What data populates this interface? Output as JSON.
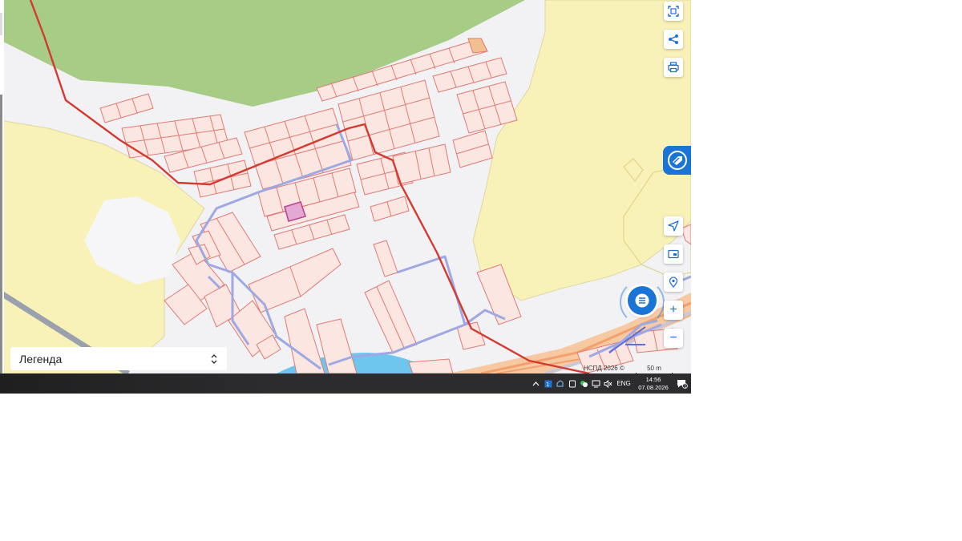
{
  "legend": {
    "label": "Легенда"
  },
  "attribution": "НСПД 2026 ©",
  "scale": {
    "label": "50 m"
  },
  "map_controls": [
    {
      "name": "select-area-icon",
      "action": "Select area"
    },
    {
      "name": "share-icon",
      "action": "Share"
    },
    {
      "name": "print-icon",
      "action": "Print"
    },
    {
      "name": "navigate-icon",
      "action": "My location"
    },
    {
      "name": "layers-icon",
      "action": "Map mode"
    },
    {
      "name": "pin-icon",
      "action": "Place marker"
    },
    {
      "name": "zoom-in-icon",
      "action": "Zoom in"
    },
    {
      "name": "zoom-out-icon",
      "action": "Zoom out"
    }
  ],
  "taskbar": {
    "language": "ENG",
    "time": "14:56",
    "date": "07.08.2026",
    "notification_count": "1"
  },
  "colors": {
    "forest": "#a6cc85",
    "field": "#f8f1b8",
    "parcel_stroke": "#e07a72",
    "parcel_fill": "#fbe6e2",
    "selected_parcel": "#d07ab8",
    "boundary_red": "#d43a2f",
    "road_blue": "#9ea8e2",
    "water": "#6ec6ef",
    "accent": "#1a74d6"
  }
}
